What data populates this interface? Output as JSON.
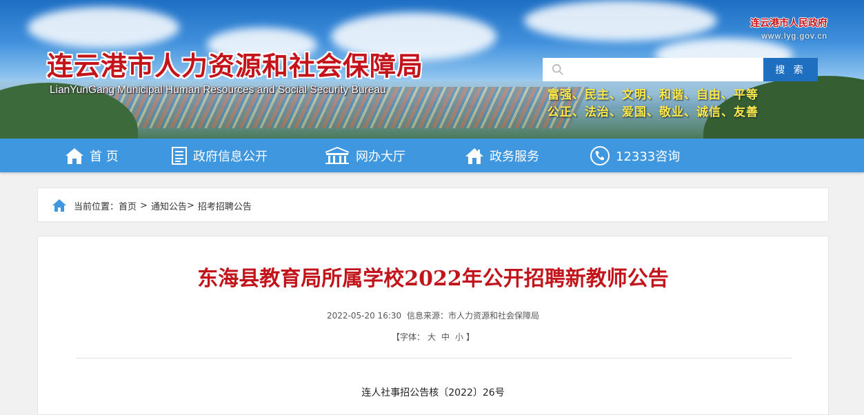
{
  "header": {
    "title": "连云港市人力资源和社会保障局",
    "subtitle": "LianYunGang Municipal Human Resources and Social Security Bureau",
    "gov_link": {
      "name": "连云港市人民政府",
      "url": "www.lyg.gov.cn"
    },
    "search": {
      "value": "",
      "placeholder": "",
      "button_label": "搜 索"
    },
    "slogan_line1": "富强、民主、文明、和谐、自由、平等",
    "slogan_line2": "公正、法治、爱国、敬业、诚信、友善"
  },
  "nav": {
    "items": [
      {
        "label": "首 页",
        "icon": "home-icon"
      },
      {
        "label": "政府信息公开",
        "icon": "document-icon"
      },
      {
        "label": "网办大厅",
        "icon": "building-icon"
      },
      {
        "label": "政务服务",
        "icon": "house-service-icon"
      },
      {
        "label": "12333咨询",
        "icon": "phone-icon"
      }
    ]
  },
  "breadcrumb": {
    "prefix": "当前位置：",
    "items": [
      "首页",
      "通知公告",
      "招考招聘公告"
    ],
    "separator": ">"
  },
  "article": {
    "title": "东海县教育局所属学校2022年公开招聘新教师公告",
    "date": "2022-05-20 16:30",
    "source": "信息来源：市人力资源和社会保障局",
    "font_size": {
      "open": "【字体：",
      "large": "大",
      "medium": "中",
      "small": "小",
      "close": "】"
    },
    "doc_number": "连人社事招公告核〔2022〕26号"
  },
  "colors": {
    "nav_bg": "#3f97e0",
    "title_red": "#c1141b",
    "search_button": "#1f6fc1",
    "slogan_yellow": "#ffe94a",
    "page_bg": "#f1f1f1"
  }
}
